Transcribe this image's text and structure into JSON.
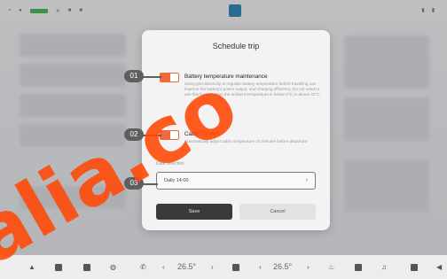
{
  "dialog": {
    "title": "Schedule trip",
    "options": [
      {
        "marker": "01",
        "title": "Battery temperature maintenance",
        "description": "Using grid electricity to regulate battery temperature before travelling can improve the battery's power output, and charging efficiency. Do not need to use this feature when the ambient temperature is below 0°C or above 40°C.",
        "enabled": true
      },
      {
        "marker": "02",
        "title": "Cabin comfort",
        "description": "Automatically adjust cabin temperature 15 minutes before departure",
        "enabled": true
      }
    ],
    "field_label": "Date selection",
    "time": {
      "marker": "03",
      "value": "Daily 14:00",
      "chevron": "›"
    },
    "save_label": "Save",
    "cancel_label": "Cancel"
  },
  "dock": {
    "temp_left": "26.5°",
    "temp_right": "26.5°",
    "arrow_left": "‹",
    "arrow_right": "›"
  },
  "colors": {
    "accent": "#f2683a",
    "watermark": "#ff4a0a",
    "marker": "#5f5f60"
  },
  "watermark": "alia.co"
}
